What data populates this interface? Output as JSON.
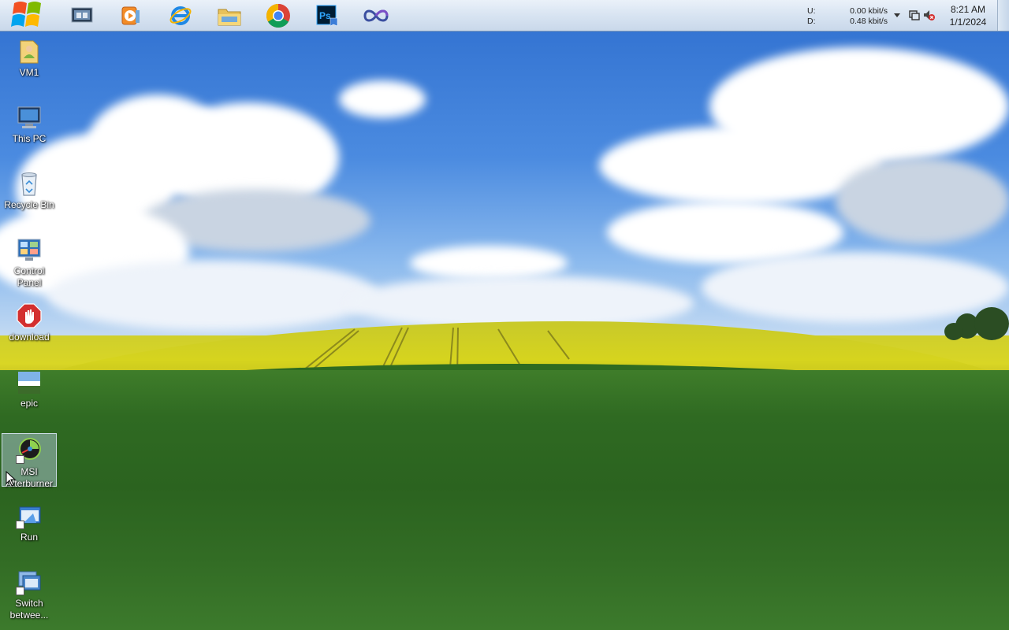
{
  "taskbar": {
    "start_button": "start-orb-icon",
    "pinned": [
      {
        "name": "taskbar-task-manager",
        "icon": "task-manager-icon"
      },
      {
        "name": "taskbar-media-player",
        "icon": "media-player-icon"
      },
      {
        "name": "taskbar-internet-explorer",
        "icon": "internet-explorer-icon"
      },
      {
        "name": "taskbar-file-explorer",
        "icon": "folder-icon"
      },
      {
        "name": "taskbar-chrome",
        "icon": "chrome-icon"
      },
      {
        "name": "taskbar-photoshop",
        "icon": "photoshop-icon"
      },
      {
        "name": "taskbar-app",
        "icon": "infinity-icon"
      }
    ],
    "tray": {
      "upload_label": "U:",
      "download_label": "D:",
      "upload_value": "0.00 kbit/s",
      "download_value": "0.48 kbit/s",
      "time": "8:21 AM",
      "date": "1/1/2024"
    }
  },
  "desktop": {
    "icons": [
      {
        "label": "VM1",
        "icon": "user-folder-icon"
      },
      {
        "label": "This PC",
        "icon": "computer-icon"
      },
      {
        "label": "Recycle Bin",
        "icon": "recycle-bin-icon"
      },
      {
        "label": "Control\nPanel",
        "icon": "control-panel-icon"
      },
      {
        "label": "download",
        "icon": "stop-hand-icon"
      },
      {
        "label": "epic",
        "icon": "image-file-icon"
      },
      {
        "label": "MSI\nAfterburner",
        "icon": "msi-afterburner-icon"
      },
      {
        "label": "Run",
        "icon": "run-icon"
      },
      {
        "label": "Switch\nbetwee...",
        "icon": "switch-windows-icon"
      }
    ]
  },
  "colors": {
    "sky": "#3a7bd0",
    "field_yellow": "#d6d41e",
    "field_green": "#2f6a22",
    "taskbar": "#d8e4f2"
  }
}
